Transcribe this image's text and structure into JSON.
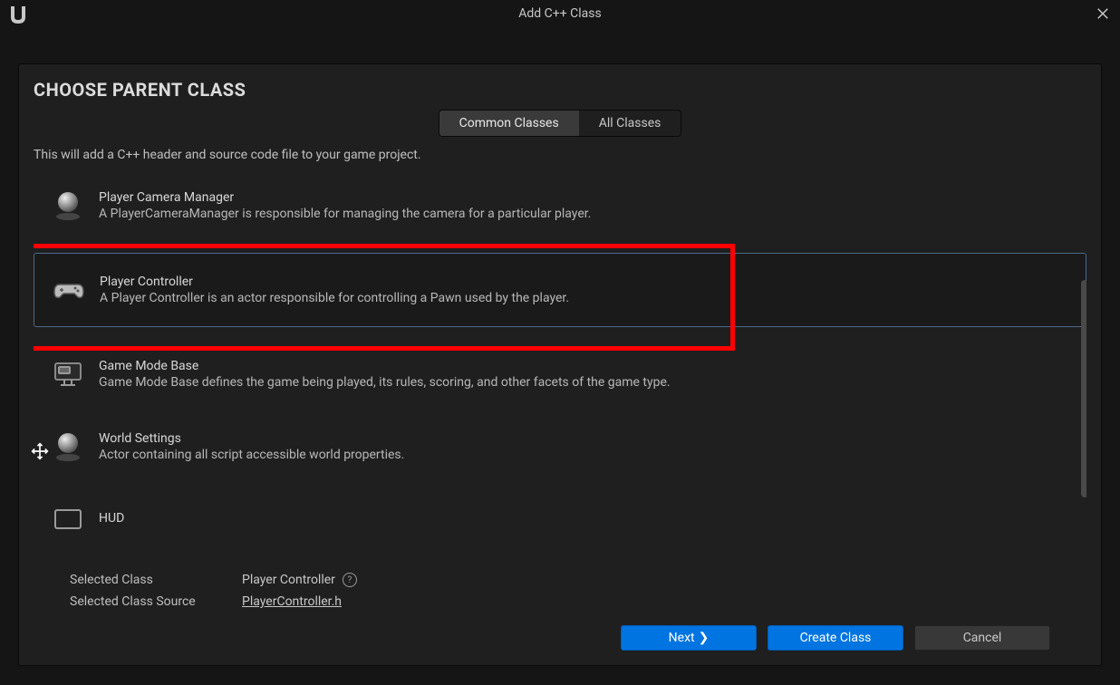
{
  "window": {
    "title": "Add C++ Class"
  },
  "heading": "CHOOSE PARENT CLASS",
  "tabs": {
    "common": "Common Classes",
    "all": "All Classes"
  },
  "description": "This will add a C++ header and source code file to your game project.",
  "classes": [
    {
      "title": "Player Camera Manager",
      "desc": "A PlayerCameraManager is responsible for managing the camera for a particular player."
    },
    {
      "title": "Player Controller",
      "desc": "A Player Controller is an actor responsible for controlling a Pawn used by the player."
    },
    {
      "title": "Game Mode Base",
      "desc": "Game Mode Base defines the game being played, its rules, scoring, and other facets of the game type."
    },
    {
      "title": "World Settings",
      "desc": "Actor containing all script accessible world properties."
    },
    {
      "title": "HUD",
      "desc": ""
    }
  ],
  "footer": {
    "selected_class_label": "Selected Class",
    "selected_class_value": "Player Controller",
    "selected_source_label": "Selected Class Source",
    "selected_source_value": "PlayerController.h"
  },
  "buttons": {
    "next": "Next",
    "create": "Create Class",
    "cancel": "Cancel"
  }
}
